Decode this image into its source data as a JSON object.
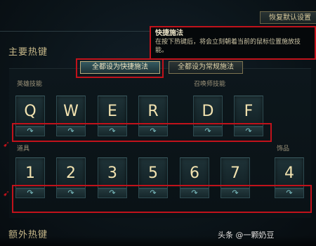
{
  "header": {
    "reset_label": "恢复默认设置"
  },
  "section": {
    "main_hotkeys": "主要热键",
    "extra_hotkeys": "额外热键"
  },
  "tooltip": {
    "title": "快捷施法",
    "body": "在按下热键后，将会立刻朝着当前的鼠标位置施放技能。"
  },
  "mode_buttons": {
    "all_quick": "全都设为快捷施法",
    "all_normal": "全都设为常规施法"
  },
  "groups": {
    "champion_skills": "英雄技能",
    "summoner_skills": "召唤师技能",
    "items": "道具",
    "trinket": "饰品"
  },
  "skill_keys": [
    "Q",
    "W",
    "E",
    "R"
  ],
  "summoner_keys": [
    "D",
    "F"
  ],
  "item_keys": [
    "1",
    "2",
    "3",
    "5",
    "6",
    "7"
  ],
  "trinket_key": "4",
  "cast_icon": "↷",
  "watermark": "头条 @一颗奶豆",
  "colors": {
    "highlight": "#c1121b",
    "key_text": "#f2e3b0",
    "label_gold": "#c8b98a"
  }
}
